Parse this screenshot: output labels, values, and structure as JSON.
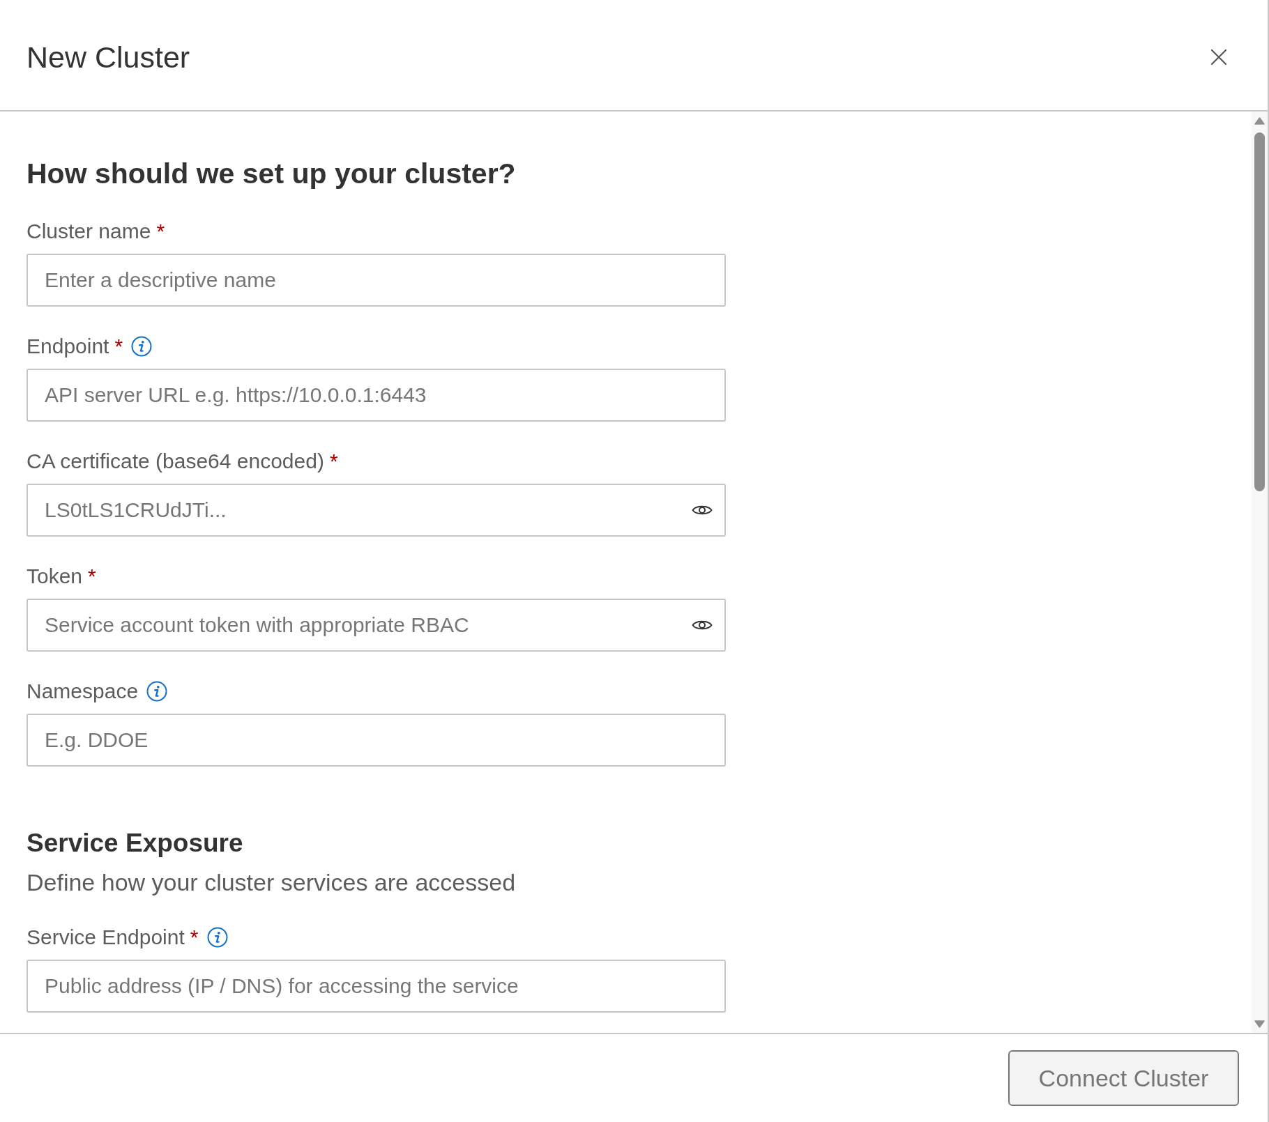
{
  "dialog": {
    "title": "New Cluster"
  },
  "form": {
    "heading": "How should we set up your cluster?",
    "fields": [
      {
        "label": "Cluster name",
        "required_mark": "*",
        "info": false,
        "placeholder": "Enter a descriptive name",
        "reveal": false
      },
      {
        "label": "Endpoint",
        "required_mark": "*",
        "info": true,
        "placeholder": "API server URL e.g. https://10.0.0.1:6443",
        "reveal": false
      },
      {
        "label": "CA certificate (base64 encoded)",
        "required_mark": "*",
        "info": false,
        "placeholder": "LS0tLS1CRUdJTi...",
        "reveal": true
      },
      {
        "label": "Token",
        "required_mark": "*",
        "info": false,
        "placeholder": "Service account token with appropriate RBAC",
        "reveal": true
      },
      {
        "label": "Namespace",
        "info": true,
        "placeholder": "E.g. DDOE",
        "reveal": false
      }
    ]
  },
  "service_exposure": {
    "heading": "Service Exposure",
    "description": "Define how your cluster services are accessed",
    "fields": [
      {
        "label": "Service Endpoint",
        "required_mark": "*",
        "info": true,
        "placeholder": "Public address (IP / DNS) for accessing the service",
        "reveal": false
      }
    ]
  },
  "footer": {
    "buttons": [
      {
        "label": "Connect Cluster",
        "disabled": true
      }
    ]
  }
}
